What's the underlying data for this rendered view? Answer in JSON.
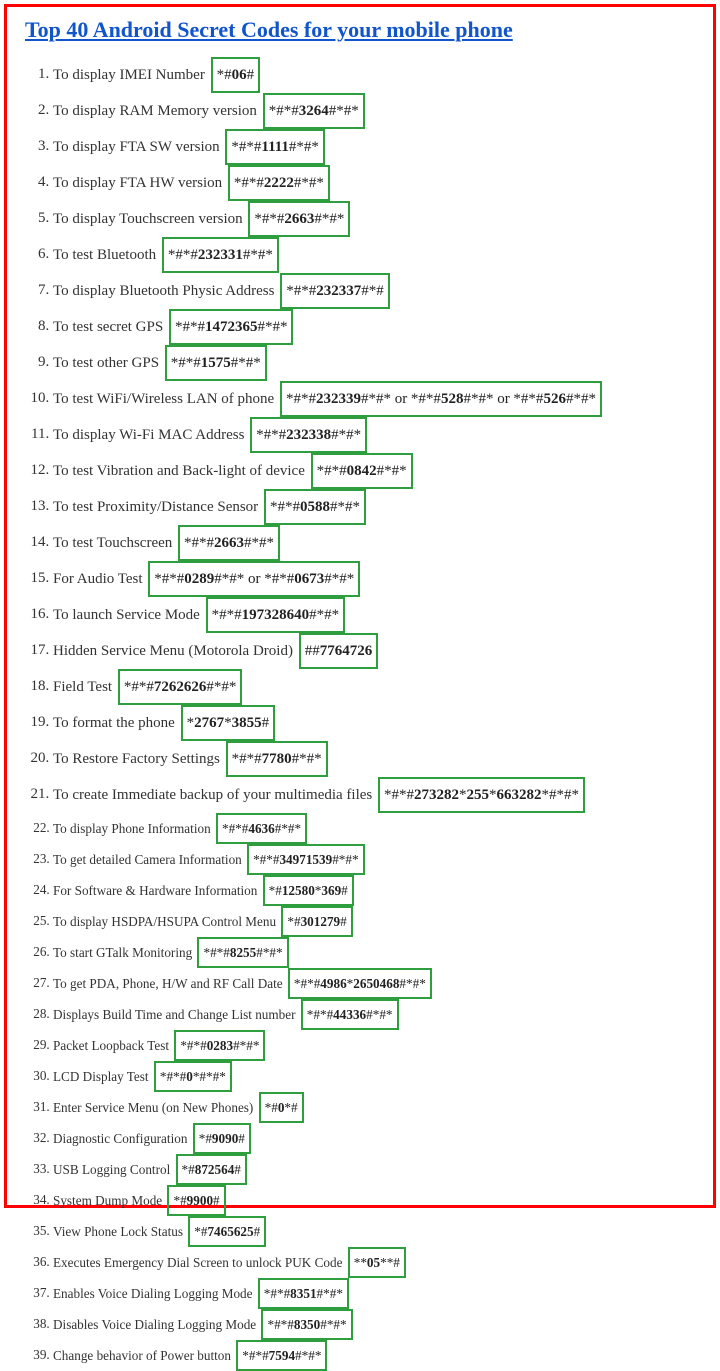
{
  "title": "Top 40 Android Secret Codes for your mobile phone",
  "items": [
    {
      "desc": "To display IMEI Number",
      "codes": [
        "*#06#"
      ]
    },
    {
      "desc": "To display RAM Memory version",
      "codes": [
        "*#*#3264#*#*"
      ]
    },
    {
      "desc": "To display FTA SW version",
      "codes": [
        "*#*#1111#*#*"
      ]
    },
    {
      "desc": "To display FTA HW version",
      "codes": [
        "*#*#2222#*#*"
      ]
    },
    {
      "desc": "To display Touchscreen version",
      "codes": [
        "*#*#2663#*#*"
      ]
    },
    {
      "desc": "To test Bluetooth",
      "codes": [
        "*#*#232331#*#*"
      ]
    },
    {
      "desc": "To display Bluetooth Physic Address",
      "codes": [
        "*#*#232337#*#"
      ]
    },
    {
      "desc": "To test secret GPS",
      "codes": [
        "*#*#1472365#*#*"
      ]
    },
    {
      "desc": "To test other GPS",
      "codes": [
        "*#*#1575#*#*"
      ]
    },
    {
      "desc": "To test WiFi/Wireless LAN of phone",
      "codes": [
        "*#*#232339#*#* or *#*#528#*#* or *#*#526#*#*"
      ]
    },
    {
      "desc": "To display Wi-Fi MAC Address",
      "codes": [
        "*#*#232338#*#*"
      ]
    },
    {
      "desc": "To test Vibration and Back-light of device",
      "codes": [
        "*#*#0842#*#*"
      ]
    },
    {
      "desc": "To test Proximity/Distance Sensor",
      "codes": [
        "*#*#0588#*#*"
      ]
    },
    {
      "desc": "To test Touchscreen",
      "codes": [
        "*#*#2663#*#*"
      ]
    },
    {
      "desc": "For Audio Test",
      "codes": [
        "*#*#0289#*#* or *#*#0673#*#*"
      ]
    },
    {
      "desc": "To launch Service Mode",
      "codes": [
        "*#*#197328640#*#*"
      ]
    },
    {
      "desc": "Hidden Service Menu (Motorola Droid)",
      "codes": [
        "##7764726"
      ]
    },
    {
      "desc": "Field Test",
      "codes": [
        "*#*#7262626#*#*"
      ]
    },
    {
      "desc": "To format the phone",
      "codes": [
        "*2767*3855#"
      ]
    },
    {
      "desc": "To Restore Factory Settings",
      "codes": [
        "*#*#7780#*#*"
      ]
    },
    {
      "desc": "To create Immediate backup of your multimedia files",
      "codes": [
        "*#*#273282*255*663282*#*#*"
      ]
    },
    {
      "desc": "To display Phone Information",
      "codes": [
        "*#*#4636#*#*"
      ]
    },
    {
      "desc": "To get detailed Camera Information",
      "codes": [
        "*#*#34971539#*#*"
      ]
    },
    {
      "desc": "For Software & Hardware Information",
      "codes": [
        "*#12580*369#"
      ]
    },
    {
      "desc": "To display HSDPA/HSUPA Control Menu",
      "codes": [
        "*#301279#"
      ]
    },
    {
      "desc": "To start GTalk Monitoring",
      "codes": [
        "*#*#8255#*#*"
      ]
    },
    {
      "desc": "To get PDA, Phone, H/W and RF Call Date",
      "codes": [
        "*#*#4986*2650468#*#*"
      ]
    },
    {
      "desc": "Displays Build Time and Change List number",
      "codes": [
        "*#*#44336#*#*"
      ]
    },
    {
      "desc": "Packet Loopback Test",
      "codes": [
        "*#*#0283#*#*"
      ]
    },
    {
      "desc": "LCD  Display Test",
      "codes": [
        "*#*#0*#*#*"
      ]
    },
    {
      "desc": "Enter Service Menu (on New Phones)",
      "codes": [
        "*#0*#"
      ]
    },
    {
      "desc": "Diagnostic Configuration",
      "codes": [
        "*#9090#"
      ]
    },
    {
      "desc": "USB Logging Control",
      "codes": [
        "*#872564#"
      ]
    },
    {
      "desc": "System Dump Mode",
      "codes": [
        "*#9900#"
      ]
    },
    {
      "desc": "View Phone Lock Status",
      "codes": [
        "*#7465625#"
      ]
    },
    {
      "desc": "Executes Emergency Dial Screen to unlock PUK Code",
      "codes": [
        "**05**#"
      ]
    },
    {
      "desc": "Enables Voice Dialing Logging Mode",
      "codes": [
        "*#*#8351#*#*"
      ]
    },
    {
      "desc": "Disables Voice Dialing Logging Mode",
      "codes": [
        "*#*#8350#*#*"
      ]
    },
    {
      "desc": "Change behavior of Power button",
      "codes": [
        "*#*#7594#*#*"
      ]
    }
  ],
  "size_break_index": 21
}
